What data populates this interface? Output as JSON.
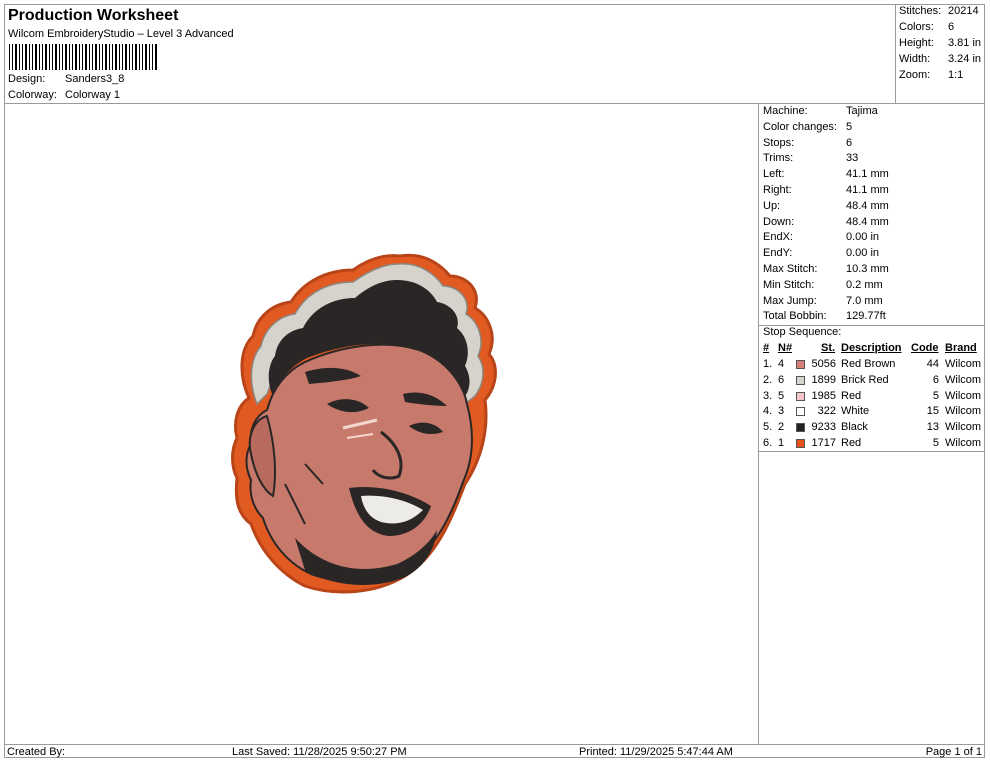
{
  "header": {
    "title": "Production Worksheet",
    "subtitle": "Wilcom EmbroideryStudio – Level 3 Advanced",
    "design_label": "Design:",
    "design_value": "Sanders3_8",
    "colorway_label": "Colorway:",
    "colorway_value": "Colorway 1"
  },
  "stats": {
    "stitches_label": "Stitches:",
    "stitches_value": "20214",
    "colors_label": "Colors:",
    "colors_value": "6",
    "height_label": "Height:",
    "height_value": "3.81 in",
    "width_label": "Width:",
    "width_value": "3.24 in",
    "zoom_label": "Zoom:",
    "zoom_value": "1:1"
  },
  "machine_info": [
    {
      "label": "Machine:",
      "value": "Tajima"
    },
    {
      "label": "Color changes:",
      "value": "5"
    },
    {
      "label": "Stops:",
      "value": "6"
    },
    {
      "label": "Trims:",
      "value": "33"
    },
    {
      "label": "Left:",
      "value": "41.1 mm"
    },
    {
      "label": "Right:",
      "value": "41.1 mm"
    },
    {
      "label": "Up:",
      "value": "48.4 mm"
    },
    {
      "label": "Down:",
      "value": "48.4 mm"
    },
    {
      "label": "EndX:",
      "value": "0.00 in"
    },
    {
      "label": "EndY:",
      "value": "0.00 in"
    },
    {
      "label": "Max Stitch:",
      "value": "10.3 mm"
    },
    {
      "label": "Min Stitch:",
      "value": "0.2 mm"
    },
    {
      "label": "Max Jump:",
      "value": "7.0 mm"
    },
    {
      "label": "Total Bobbin:",
      "value": "129.77ft"
    }
  ],
  "stop_sequence": {
    "title": "Stop Sequence:",
    "headers": {
      "seq": "#",
      "needle": "N#",
      "stitches": "St.",
      "description": "Description",
      "code": "Code",
      "brand": "Brand"
    },
    "rows": [
      {
        "seq": "1.",
        "needle": "4",
        "color": "#d9807a",
        "stitches": "5056",
        "description": "Red Brown",
        "code": "44",
        "brand": "Wilcom"
      },
      {
        "seq": "2.",
        "needle": "6",
        "color": "#d8d4d0",
        "stitches": "1899",
        "description": "Brick Red",
        "code": "6",
        "brand": "Wilcom"
      },
      {
        "seq": "3.",
        "needle": "5",
        "color": "#f4c8c8",
        "stitches": "1985",
        "description": "Red",
        "code": "5",
        "brand": "Wilcom"
      },
      {
        "seq": "4.",
        "needle": "3",
        "color": "#ffffff",
        "stitches": "322",
        "description": "White",
        "code": "15",
        "brand": "Wilcom"
      },
      {
        "seq": "5.",
        "needle": "2",
        "color": "#222222",
        "stitches": "9233",
        "description": "Black",
        "code": "13",
        "brand": "Wilcom"
      },
      {
        "seq": "6.",
        "needle": "1",
        "color": "#e8501a",
        "stitches": "1717",
        "description": "Red",
        "code": "5",
        "brand": "Wilcom"
      }
    ]
  },
  "footer": {
    "created_by": "Created By:",
    "last_saved": "Last Saved: 11/28/2025 9:50:27 PM",
    "printed": "Printed: 11/29/2025 5:47:44 AM",
    "page": "Page 1 of 1"
  },
  "colors": {
    "border": "#9a9a9a",
    "outline_orange": "#d9531f",
    "skin": "#c77a6c",
    "hair_dark": "#2a2626",
    "hair_light": "#d6d2cc"
  }
}
